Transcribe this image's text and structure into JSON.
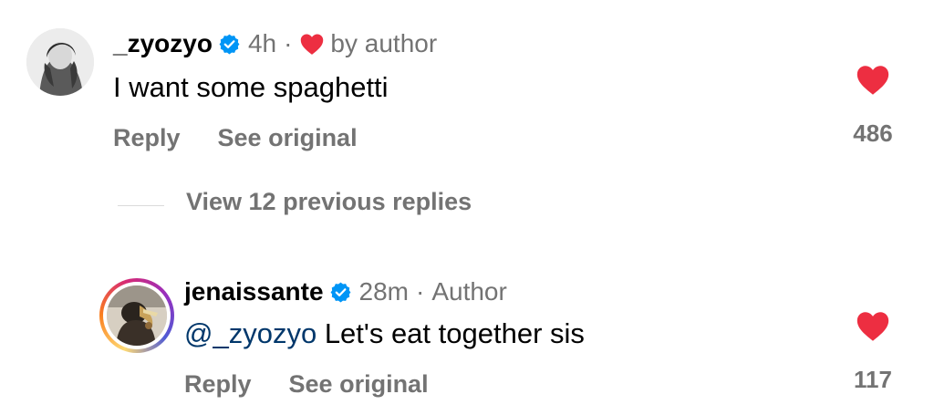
{
  "comments": [
    {
      "username": "_zyozyo",
      "verified": true,
      "time": "4h",
      "separator": "·",
      "liked_by_author_label": "by author",
      "text": "I want some spaghetti",
      "actions": {
        "reply": "Reply",
        "see_original": "See original"
      },
      "likes": "486",
      "like_icon": "heart-icon",
      "avatar_icon": "profile-photo"
    }
  ],
  "view_replies_label": "View 12 previous replies",
  "reply": {
    "username": "jenaissante",
    "verified": true,
    "time": "28m",
    "separator": "·",
    "role": "Author",
    "mention": "@_zyozyo",
    "text": " Let's eat together sis",
    "actions": {
      "reply": "Reply",
      "see_original": "See original"
    },
    "likes": "117",
    "like_icon": "heart-icon",
    "avatar_icon": "profile-photo-with-story-ring"
  },
  "colors": {
    "like_red": "#ed2e41",
    "verified_blue": "#0095f6",
    "secondary_text": "#737373",
    "mention_blue": "#00376b"
  }
}
